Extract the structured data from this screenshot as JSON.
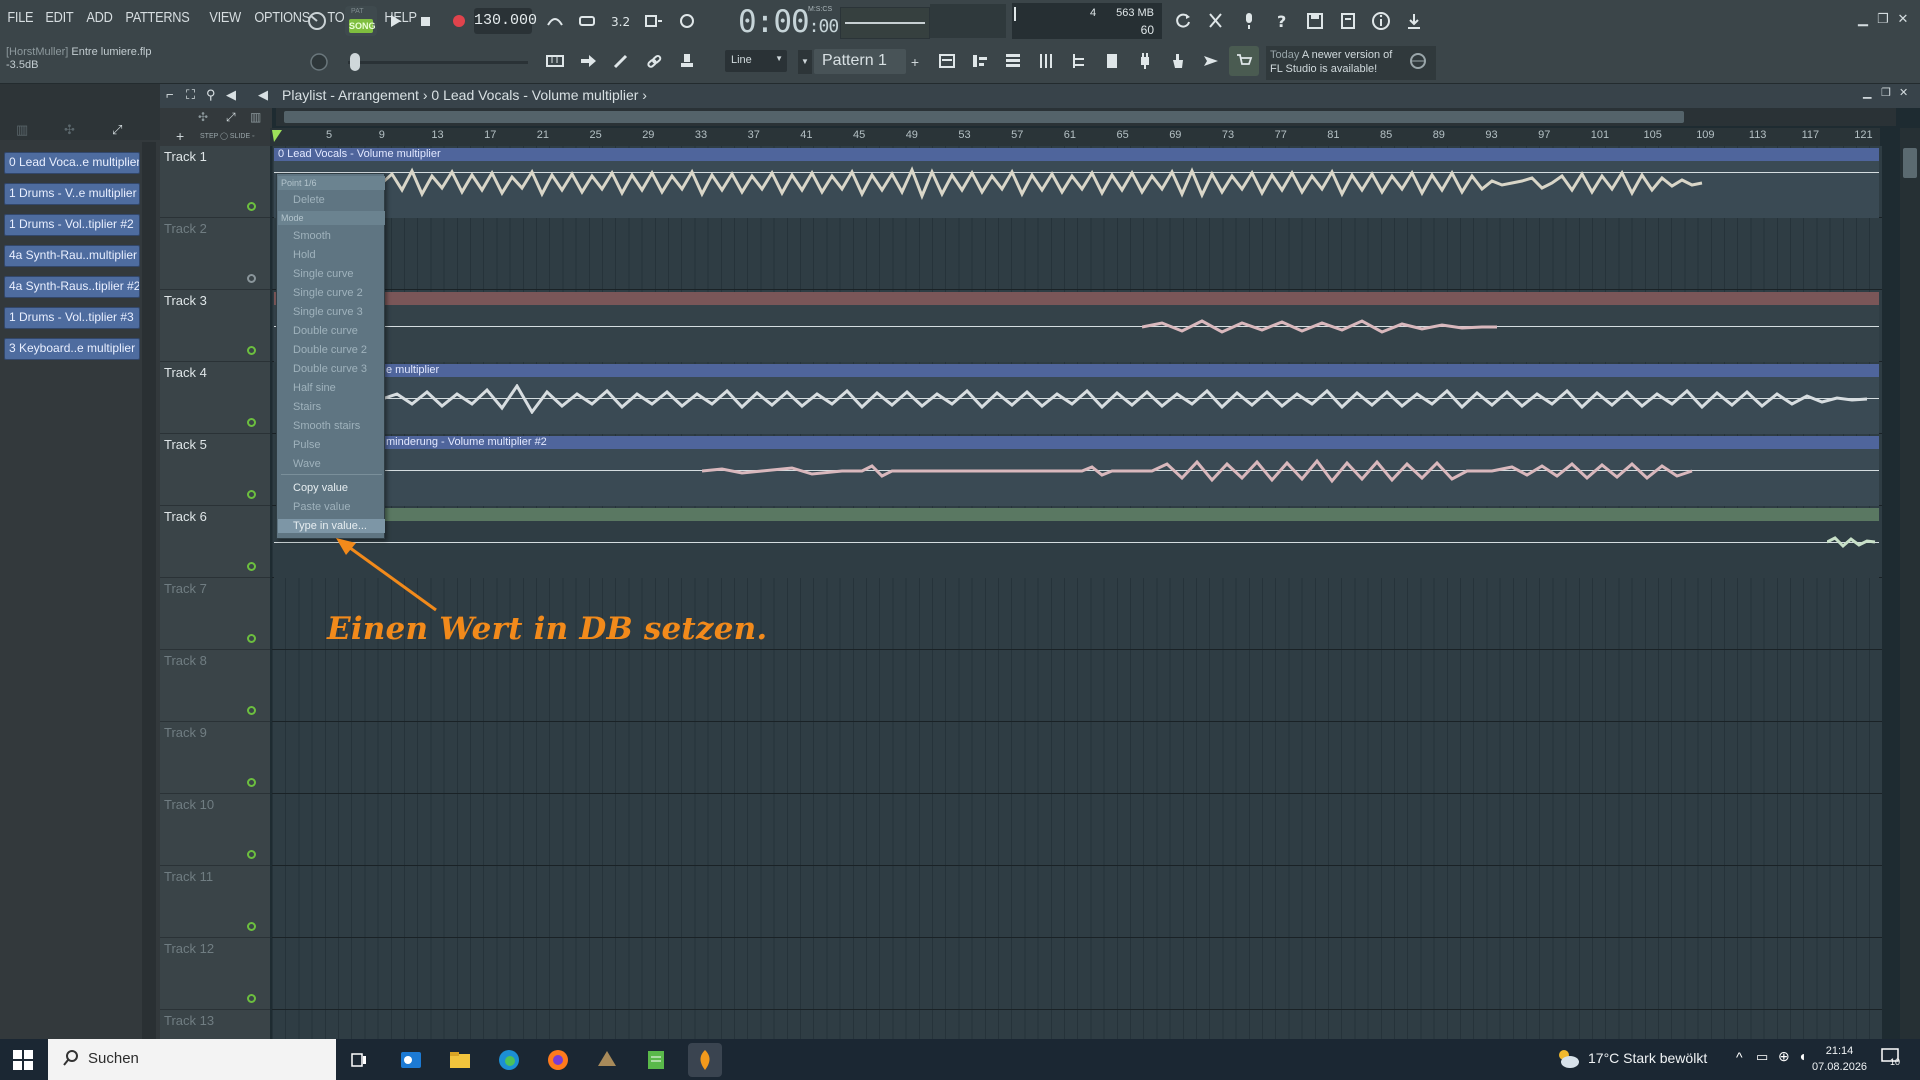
{
  "menu": [
    "FILE",
    "EDIT",
    "ADD",
    "PATTERNS",
    "VIEW",
    "OPTIONS",
    "TOOLS",
    "HELP"
  ],
  "transport": {
    "mode_pat": "PAT",
    "mode_song": "SONG",
    "tempo": "130.000",
    "time_main": "0:00",
    "time_sub": ":00",
    "time_label": "M:S:CS",
    "cpu_value": "4",
    "memory": "563 MB",
    "polyphony": "60"
  },
  "hint": {
    "owner": "[HorstMuller]",
    "file": "Entre lumiere.flp",
    "value": "-3.5dB"
  },
  "toolbar2": {
    "snap": "Line",
    "pattern": "Pattern 1",
    "news_today": "Today",
    "news_text_1": "A newer version of",
    "news_text_2": "FL Studio is available!"
  },
  "playlist": {
    "title": "Playlist - Arrangement",
    "sep1": "›",
    "clip_context": "0 Lead Vocals - Volume multiplier",
    "sep2": "›"
  },
  "browser_clips": [
    "0 Lead Voca..e multiplier",
    "1 Drums - V..e multiplier",
    "1 Drums - Vol..tiplier #2",
    "4a Synth-Rau..multiplier",
    "4a Synth-Raus..tiplier #2",
    "1 Drums - Vol..tiplier #3",
    "3 Keyboard..e multiplier"
  ],
  "ruler": [
    "5",
    "9",
    "13",
    "17",
    "21",
    "25",
    "29",
    "33",
    "37",
    "41",
    "45",
    "49",
    "53",
    "57",
    "61",
    "65",
    "69",
    "73",
    "77",
    "81",
    "85",
    "89",
    "93",
    "97",
    "101",
    "105",
    "109",
    "113",
    "117",
    "121"
  ],
  "tracks": [
    "Track 1",
    "Track 2",
    "Track 3",
    "Track 4",
    "Track 5",
    "Track 6",
    "Track 7",
    "Track 8",
    "Track 9",
    "Track 10",
    "Track 11",
    "Track 12",
    "Track 13"
  ],
  "lanes": {
    "clip1_label": "0 Lead Vocals - Volume multiplier",
    "clip4_label": "e multiplier",
    "clip5_label": "minderung - Volume multiplier #2"
  },
  "context_menu": {
    "heading_point": "Point 1/6",
    "delete": "Delete",
    "heading_mode": "Mode",
    "modes": [
      "Smooth",
      "Hold",
      "Single curve",
      "Single curve 2",
      "Single curve 3",
      "Double curve",
      "Double curve 2",
      "Double curve 3",
      "Half sine",
      "Stairs",
      "Smooth stairs",
      "Pulse",
      "Wave"
    ],
    "copy_value": "Copy value",
    "paste_value": "Paste value",
    "type_in_value": "Type in value..."
  },
  "annotation": "Einen Wert in DB setzen.",
  "taskbar": {
    "search_placeholder": "Suchen",
    "weather": "17°C  Stark bewölkt",
    "time": "21:14",
    "date": "07.08.2026",
    "notifications": "10"
  },
  "colors": {
    "annotation": "#f28a1b",
    "clip_blue": "#4e6c9f",
    "track3_clip": "#7a5658",
    "track6_clip": "#5a7862",
    "led_green": "#6cbf3f"
  }
}
